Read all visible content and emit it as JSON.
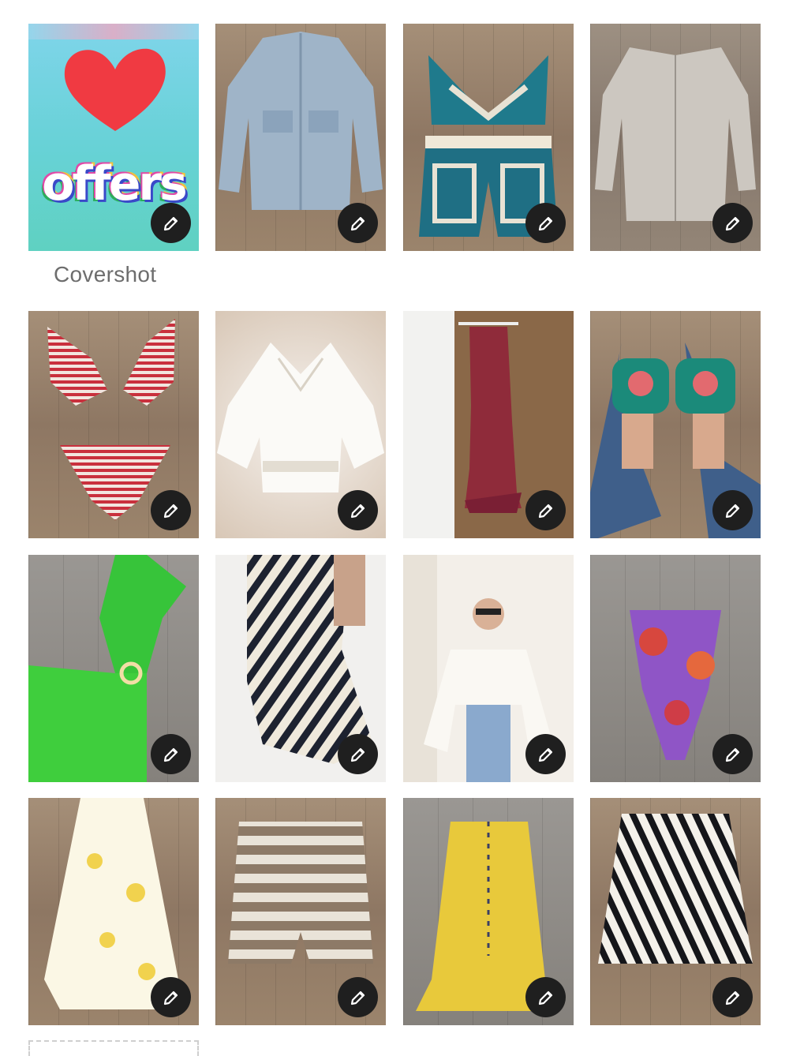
{
  "coversLabel": "Covershot",
  "cover": {
    "text": "offers",
    "heart_color": "#f03a42"
  },
  "edit_icon": "pencil-icon",
  "items": [
    {
      "id": "cover-offers"
    },
    {
      "id": "denim-jacket"
    },
    {
      "id": "crochet-set"
    },
    {
      "id": "knit-cardigan"
    },
    {
      "id": "striped-bikini"
    },
    {
      "id": "white-tunic"
    },
    {
      "id": "red-slip-dress"
    },
    {
      "id": "embroidered-slides"
    },
    {
      "id": "green-crochet-dress"
    },
    {
      "id": "zebra-maxi-skirt"
    },
    {
      "id": "white-eyelet-top"
    },
    {
      "id": "floral-swimsuit"
    },
    {
      "id": "yellow-floral-skirt"
    },
    {
      "id": "knit-shorts"
    },
    {
      "id": "yellow-ruched-skirt"
    },
    {
      "id": "zebra-mini-skirt"
    }
  ]
}
